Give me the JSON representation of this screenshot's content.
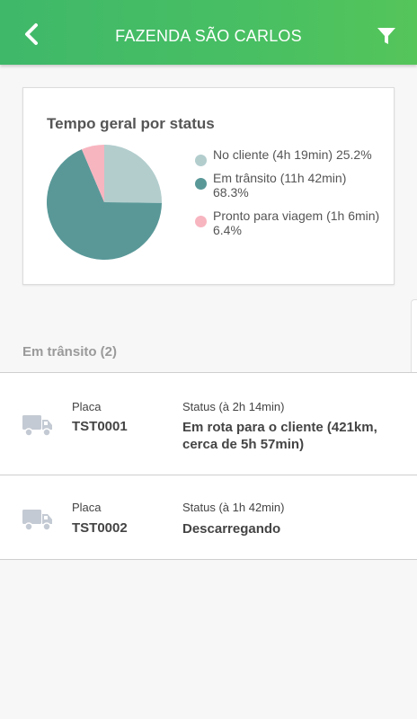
{
  "header": {
    "title": "FAZENDA SÃO CARLOS",
    "back_icon": "chevron-left-icon",
    "filter_icon": "filter-icon",
    "colors": {
      "start": "#3fb86a",
      "end": "#55c55a"
    }
  },
  "chart_card": {
    "title": "Tempo geral por status"
  },
  "chart_data": {
    "type": "pie",
    "title": "Tempo geral por status",
    "slices": [
      {
        "label": "No cliente (4h 19min) 25.2%",
        "value": 25.2,
        "color": "#b3cdcd"
      },
      {
        "label": "Em trânsito (11h 42min) 68.3%",
        "value": 68.3,
        "color": "#5a9898"
      },
      {
        "label": "Pronto para viagem (1h 6min) 6.4%",
        "value": 6.4,
        "color": "#f7b5c0"
      }
    ],
    "legend_position": "right"
  },
  "section": {
    "label": "Em trânsito (2)"
  },
  "vehicles": [
    {
      "plate_label": "Placa",
      "plate": "TST0001",
      "status_label": "Status (à 2h 14min)",
      "status": "Em rota para o cliente (421km, cerca de 5h 57min)",
      "icon": "truck-icon"
    },
    {
      "plate_label": "Placa",
      "plate": "TST0002",
      "status_label": "Status (à 1h 42min)",
      "status": "Descarregando",
      "icon": "truck-icon"
    }
  ]
}
